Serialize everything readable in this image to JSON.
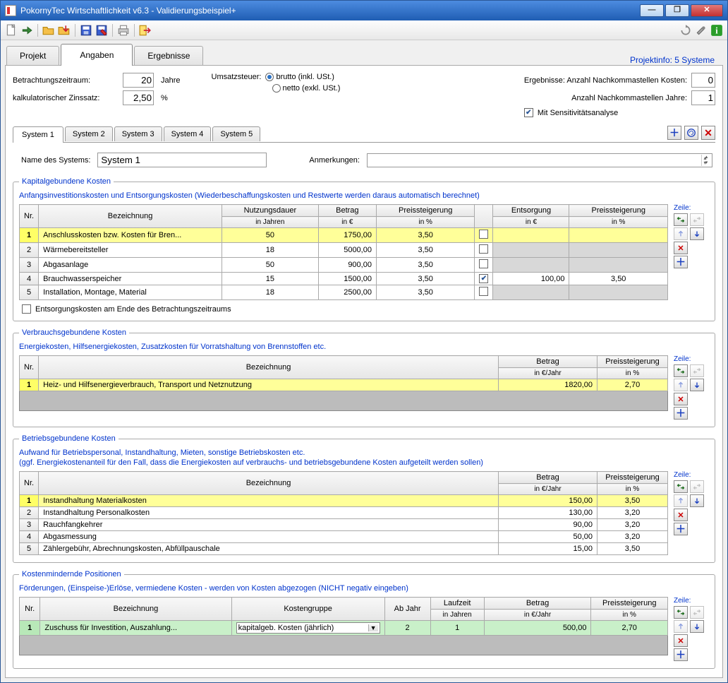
{
  "window": {
    "title": "PokornyTec  Wirtschaftlichkeit v6.3  -  Validierungsbeispiel+"
  },
  "maintabs": {
    "projekt": "Projekt",
    "angaben": "Angaben",
    "ergebnisse": "Ergebnisse"
  },
  "projinfo": "Projektinfo: 5 Systeme",
  "top": {
    "period_label": "Betrachtungszeitraum:",
    "period_val": "20",
    "period_unit": "Jahre",
    "rate_label": "kalkulatorischer Zinssatz:",
    "rate_val": "2,50",
    "rate_unit": "%",
    "vat_label": "Umsatzsteuer:",
    "brutto": "brutto (inkl. USt.)",
    "netto": "netto (exkl. USt.)",
    "res_label": "Ergebnisse: Anzahl Nachkommastellen Kosten:",
    "res_val": "0",
    "yrs_label": "Anzahl Nachkommastellen Jahre:",
    "yrs_val": "1",
    "sens_label": "Mit Sensitivitätsanalyse"
  },
  "systabs": [
    "System 1",
    "System 2",
    "System 3",
    "System 4",
    "System 5"
  ],
  "sysname_label": "Name des Systems:",
  "sysname_val": "System 1",
  "remarks_label": "Anmerkungen:",
  "zeile": "Zeile:",
  "kap": {
    "legend": "Kapitalgebundene Kosten",
    "sub": "Anfangsinvestitionskosten und Entsorgungskosten (Wiederbeschaffungskosten und Restwerte werden daraus automatisch berechnet)",
    "h": {
      "nr": "Nr.",
      "bez": "Bezeichnung",
      "nd1": "Nutzungsdauer",
      "nd2": "in Jahren",
      "bt1": "Betrag",
      "bt2": "in €",
      "ps1": "Preissteigerung",
      "ps2": "in %",
      "en1": "Entsorgung",
      "en2": "in €",
      "pe1": "Preissteigerung",
      "pe2": "in %"
    },
    "rows": [
      {
        "n": "1",
        "b": "Anschlusskosten bzw. Kosten für Bren...",
        "nd": "50",
        "bt": "1750,00",
        "ps": "3,50",
        "ec": false,
        "en": "",
        "pe": "",
        "sel": true
      },
      {
        "n": "2",
        "b": "Wärmebereitsteller",
        "nd": "18",
        "bt": "5000,00",
        "ps": "3,50",
        "ec": false,
        "en": "",
        "pe": ""
      },
      {
        "n": "3",
        "b": "Abgasanlage",
        "nd": "50",
        "bt": "900,00",
        "ps": "3,50",
        "ec": false,
        "en": "",
        "pe": ""
      },
      {
        "n": "4",
        "b": "Brauchwasserspeicher",
        "nd": "15",
        "bt": "1500,00",
        "ps": "3,50",
        "ec": true,
        "en": "100,00",
        "pe": "3,50"
      },
      {
        "n": "5",
        "b": "Installation, Montage, Material",
        "nd": "18",
        "bt": "2500,00",
        "ps": "3,50",
        "ec": false,
        "en": "",
        "pe": ""
      }
    ],
    "chk_label": "Entsorgungskosten am Ende des Betrachtungszeitraums"
  },
  "ver": {
    "legend": "Verbrauchsgebundene Kosten",
    "sub": "Energiekosten, Hilfsenergiekosten, Zusatzkosten für Vorratshaltung von Brennstoffen etc.",
    "h": {
      "nr": "Nr.",
      "bez": "Bezeichnung",
      "bt1": "Betrag",
      "bt2": "in €/Jahr",
      "ps1": "Preissteigerung",
      "ps2": "in %"
    },
    "rows": [
      {
        "n": "1",
        "b": "Heiz- und Hilfsenergieverbrauch, Transport und Netznutzung",
        "bt": "1820,00",
        "ps": "2,70",
        "sel": true
      }
    ]
  },
  "bet": {
    "legend": "Betriebsgebundene Kosten",
    "sub1": "Aufwand für Betriebspersonal, Instandhaltung, Mieten, sonstige Betriebskosten etc.",
    "sub2": "(ggf. Energiekostenanteil für den Fall, dass die Energiekosten auf verbrauchs- und betriebsgebundene Kosten aufgeteilt werden sollen)",
    "h": {
      "nr": "Nr.",
      "bez": "Bezeichnung",
      "bt1": "Betrag",
      "bt2": "in €/Jahr",
      "ps1": "Preissteigerung",
      "ps2": "in %"
    },
    "rows": [
      {
        "n": "1",
        "b": "Instandhaltung Materialkosten",
        "bt": "150,00",
        "ps": "3,50",
        "sel": true
      },
      {
        "n": "2",
        "b": "Instandhaltung Personalkosten",
        "bt": "130,00",
        "ps": "3,20"
      },
      {
        "n": "3",
        "b": "Rauchfangkehrer",
        "bt": "90,00",
        "ps": "3,20"
      },
      {
        "n": "4",
        "b": "Abgasmessung",
        "bt": "50,00",
        "ps": "3,20"
      },
      {
        "n": "5",
        "b": "Zählergebühr, Abrechnungskosten, Abfüllpauschale",
        "bt": "15,00",
        "ps": "3,50"
      }
    ]
  },
  "min": {
    "legend": "Kostenmindernde Positionen",
    "sub": "Förderungen, (Einspeise-)Erlöse, vermiedene Kosten - werden von Kosten abgezogen (NICHT negativ eingeben)",
    "h": {
      "nr": "Nr.",
      "bez": "Bezeichnung",
      "kg": "Kostengruppe",
      "aj": "Ab Jahr",
      "lz1": "Laufzeit",
      "lz2": "in Jahren",
      "bt1": "Betrag",
      "bt2": "in €/Jahr",
      "ps1": "Preissteigerung",
      "ps2": "in %"
    },
    "rows": [
      {
        "n": "1",
        "b": "Zuschuss für Investition, Auszahlung...",
        "kg": "kapitalgeb. Kosten (jährlich)",
        "aj": "2",
        "lz": "1",
        "bt": "500,00",
        "ps": "2,70",
        "green": true
      }
    ]
  }
}
